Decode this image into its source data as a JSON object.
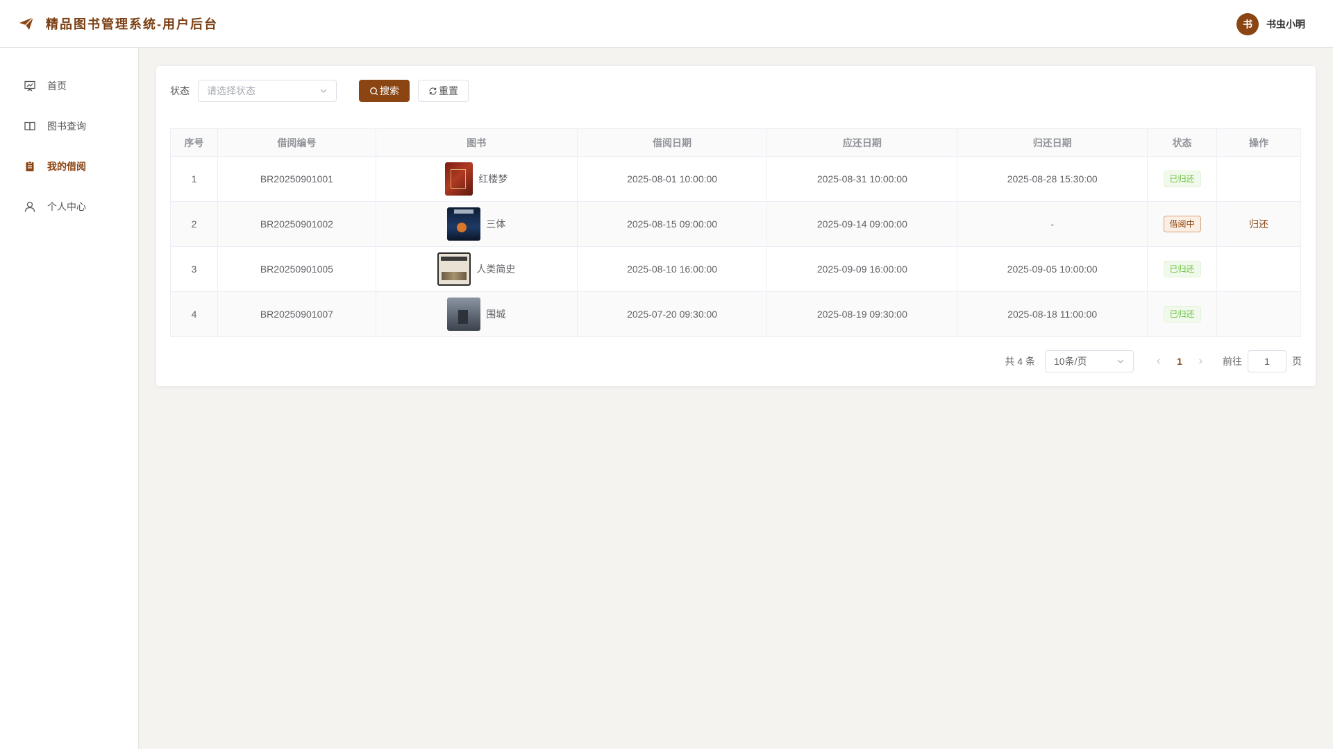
{
  "header": {
    "title": "精品图书管理系统-用户后台",
    "user": {
      "avatar_text": "书",
      "name": "书虫小明"
    }
  },
  "sidebar": {
    "items": [
      {
        "label": "首页",
        "icon": "presentation-board-icon"
      },
      {
        "label": "图书查询",
        "icon": "open-book-icon"
      },
      {
        "label": "我的借阅",
        "icon": "clipboard-icon",
        "active": true
      },
      {
        "label": "个人中心",
        "icon": "user-icon"
      }
    ]
  },
  "filter": {
    "label": "状态",
    "placeholder": "请选择状态",
    "search_label": "搜索",
    "reset_label": "重置"
  },
  "table": {
    "columns": [
      "序号",
      "借阅编号",
      "图书",
      "借阅日期",
      "应还日期",
      "归还日期",
      "状态",
      "操作"
    ],
    "rows": [
      {
        "index": "1",
        "borrow_no": "BR20250901001",
        "book": "红楼梦",
        "borrow_date": "2025-08-01 10:00:00",
        "due_date": "2025-08-31 10:00:00",
        "return_date": "2025-08-28 15:30:00",
        "status": "已归还",
        "action": ""
      },
      {
        "index": "2",
        "borrow_no": "BR20250901002",
        "book": "三体",
        "borrow_date": "2025-08-15 09:00:00",
        "due_date": "2025-09-14 09:00:00",
        "return_date": "-",
        "status": "借阅中",
        "action": "归还"
      },
      {
        "index": "3",
        "borrow_no": "BR20250901005",
        "book": "人类简史",
        "borrow_date": "2025-08-10 16:00:00",
        "due_date": "2025-09-09 16:00:00",
        "return_date": "2025-09-05 10:00:00",
        "status": "已归还",
        "action": ""
      },
      {
        "index": "4",
        "borrow_no": "BR20250901007",
        "book": "围城",
        "borrow_date": "2025-07-20 09:30:00",
        "due_date": "2025-08-19 09:30:00",
        "return_date": "2025-08-18 11:00:00",
        "status": "已归还",
        "action": ""
      }
    ]
  },
  "pagination": {
    "total_text": "共 4 条",
    "page_size": "10条/页",
    "current_page": "1",
    "goto_label": "前往",
    "goto_value": "1",
    "page_suffix": "页"
  },
  "colors": {
    "accent": "#8a4513",
    "returned": "#67c23a",
    "background": "#f5f3f0"
  }
}
